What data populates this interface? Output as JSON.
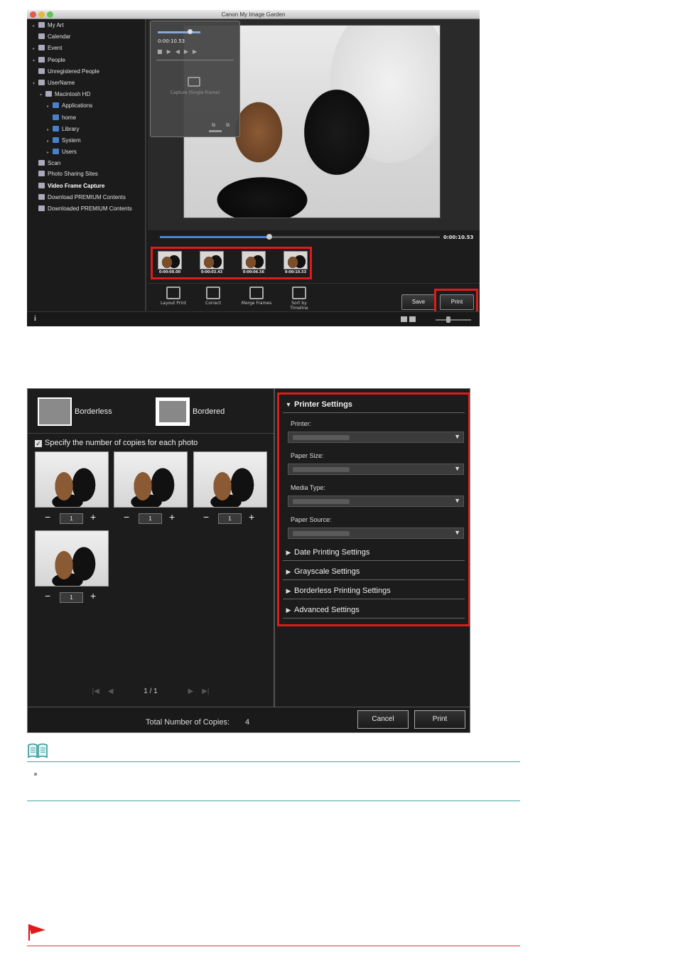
{
  "window1": {
    "title": "Canon My Image Garden",
    "sidebar": [
      {
        "label": "My Art",
        "indent": 0,
        "tri": "▸"
      },
      {
        "label": "Calendar",
        "indent": 0,
        "tri": ""
      },
      {
        "label": "Event",
        "indent": 0,
        "tri": "▸"
      },
      {
        "label": "People",
        "indent": 0,
        "tri": "▾"
      },
      {
        "label": "Unregistered People",
        "indent": 0,
        "tri": ""
      },
      {
        "label": "UserName",
        "indent": 0,
        "tri": "▾"
      },
      {
        "label": "Macintosh HD",
        "indent": 1,
        "tri": "▾"
      },
      {
        "label": "Applications",
        "indent": 2,
        "tri": "▸"
      },
      {
        "label": "home",
        "indent": 2,
        "tri": ""
      },
      {
        "label": "Library",
        "indent": 2,
        "tri": "▸"
      },
      {
        "label": "System",
        "indent": 2,
        "tri": "▸"
      },
      {
        "label": "Users",
        "indent": 2,
        "tri": "▸"
      },
      {
        "label": "Scan",
        "indent": 0,
        "tri": ""
      },
      {
        "label": "Photo Sharing Sites",
        "indent": 0,
        "tri": ""
      },
      {
        "label": "Video Frame Capture",
        "indent": 0,
        "tri": "",
        "bold": true
      },
      {
        "label": "Download PREMIUM Contents",
        "indent": 0,
        "tri": ""
      },
      {
        "label": "Downloaded PREMIUM Contents",
        "indent": 0,
        "tri": ""
      }
    ],
    "capture_panel": {
      "time": "0:00:10.53",
      "capture_label": "Capture (Single Frame)"
    },
    "seek_time": "0:00:10.53",
    "seek_progress": 0.39,
    "frames": [
      "0:00:00.00",
      "0:00:03.43",
      "0:00:06.56",
      "0:00:10.53"
    ],
    "tools": [
      "Layout Print",
      "Correct",
      "Merge Frames",
      "Sort by Timeline"
    ],
    "save_label": "Save",
    "print_label": "Print",
    "info_label": "i"
  },
  "window2": {
    "borderless_label": "Borderless",
    "bordered_label": "Bordered",
    "copies_checkbox_label": "Specify the number of copies for each photo",
    "photos": [
      {
        "copies": "1"
      },
      {
        "copies": "1"
      },
      {
        "copies": "1"
      },
      {
        "copies": "1"
      }
    ],
    "minus": "−",
    "plus": "+",
    "page_indicator": "1 / 1",
    "printer_settings_title": "Printer Settings",
    "fields": [
      {
        "label": "Printer:"
      },
      {
        "label": "Paper Size:"
      },
      {
        "label": "Media Type:"
      },
      {
        "label": "Paper Source:"
      }
    ],
    "sections": [
      "Date Printing Settings",
      "Grayscale Settings",
      "Borderless Printing Settings",
      "Advanced Settings"
    ],
    "total_label": "Total Number of Copies:",
    "total_value": "4",
    "cancel_label": "Cancel",
    "print_label": "Print"
  },
  "colors": {
    "highlight": "#e01b1b",
    "note_rule": "#4aa3a3",
    "important_rule": "#d93a3a"
  }
}
